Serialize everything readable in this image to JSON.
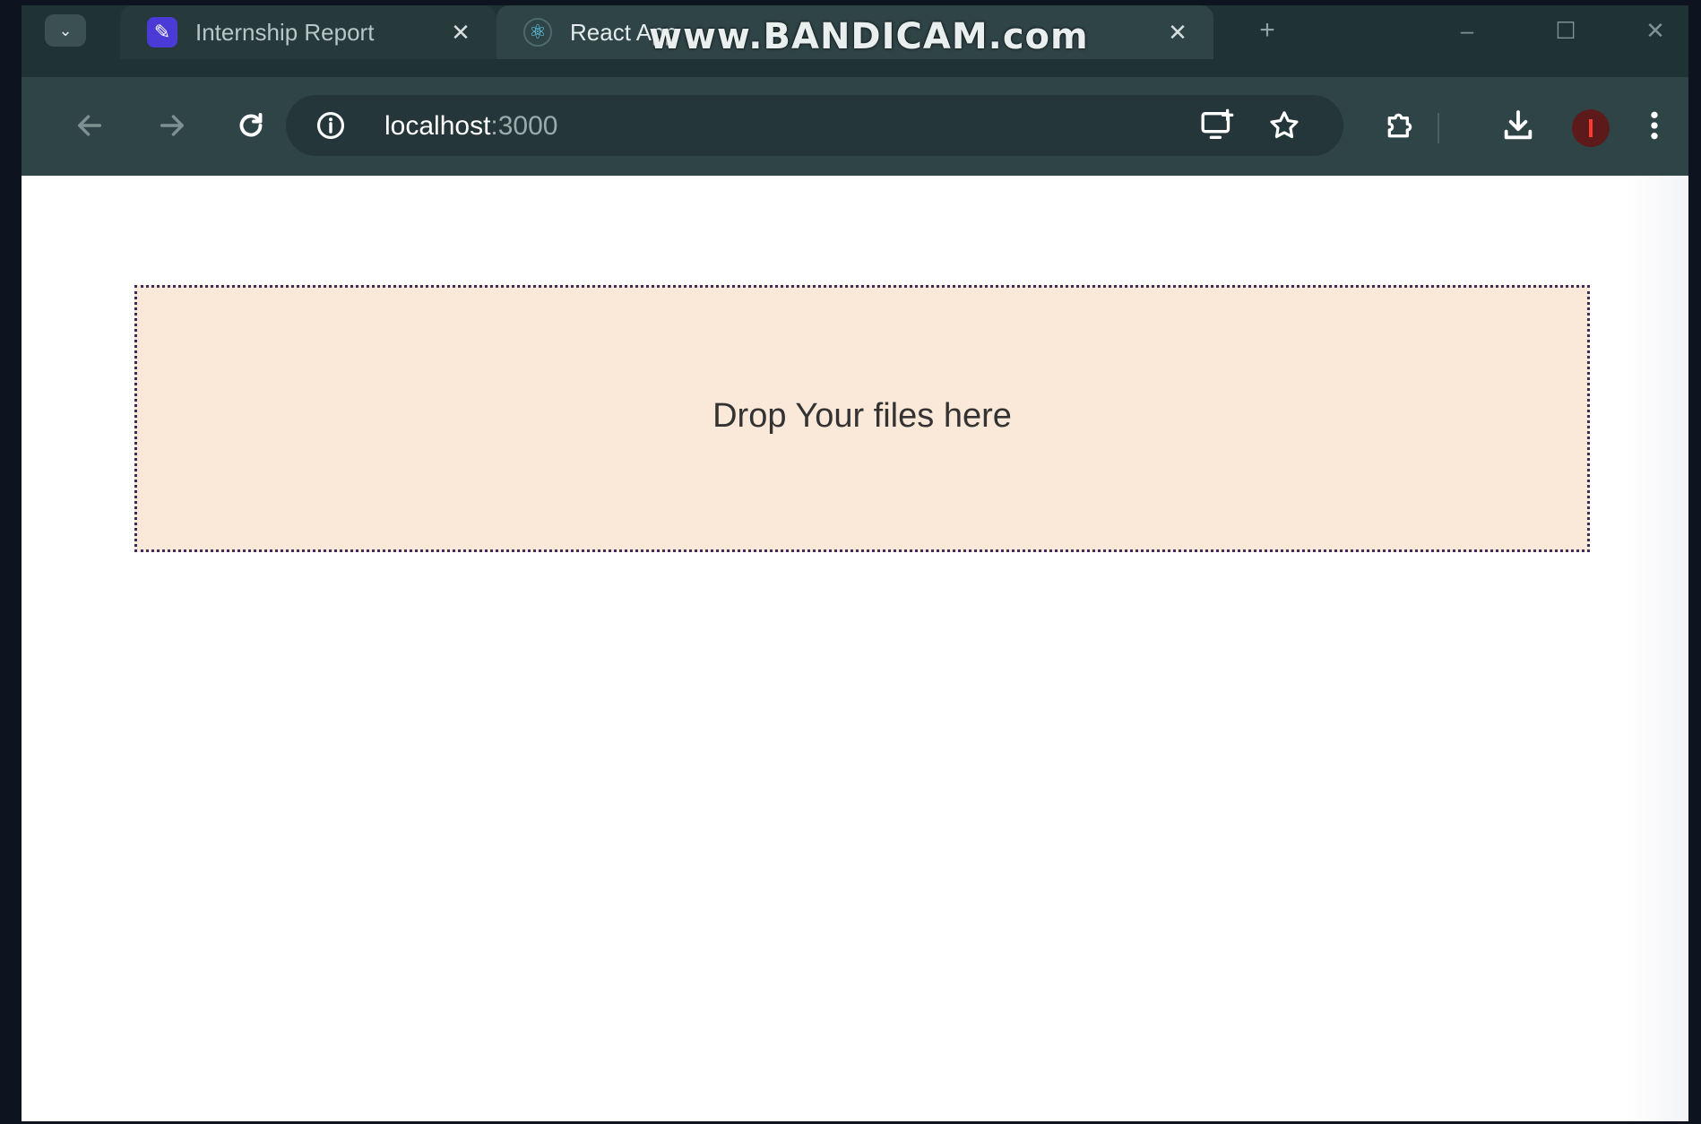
{
  "browser": {
    "tabs": [
      {
        "title": "Internship Report",
        "favicon": "report-favicon",
        "active": false
      },
      {
        "title": "React App",
        "favicon": "react-favicon",
        "active": true
      }
    ],
    "new_tab_label": "+",
    "close_label": "✕",
    "watermark": "www.BANDICAM.com",
    "address": {
      "host": "localhost",
      "port": ":3000"
    },
    "icons": {
      "back": "arrow-left-icon",
      "forward": "arrow-right-icon",
      "reload": "reload-icon",
      "site_info": "info-icon",
      "install": "install-app-icon",
      "bookmark": "star-icon",
      "extensions": "puzzle-icon",
      "downloads": "download-icon",
      "menu": "kebab-menu-icon"
    }
  },
  "page": {
    "dropzone": {
      "text": "Drop Your files here",
      "background": "#fae9d8",
      "border": "#3b2e5a"
    }
  }
}
